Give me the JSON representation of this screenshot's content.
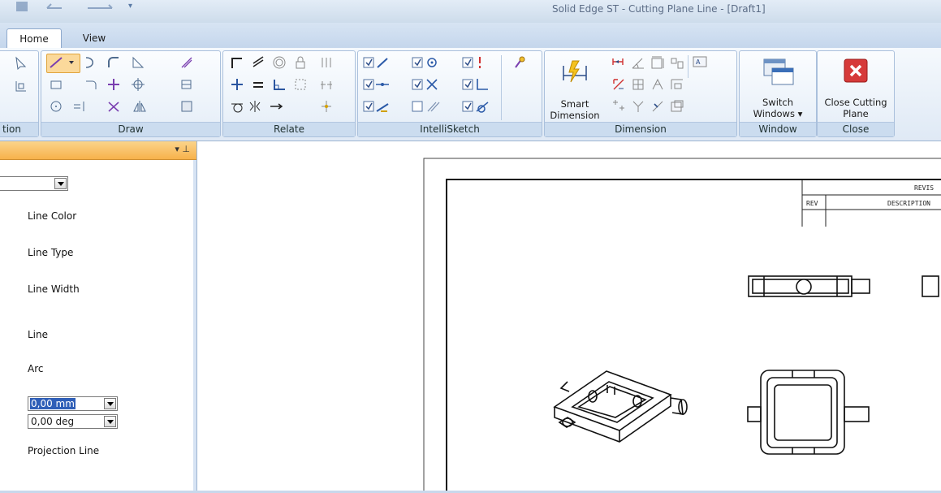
{
  "window": {
    "title": "Solid Edge ST - Cutting Plane Line - [Draft1]"
  },
  "tabs": {
    "home": "Home",
    "view": "View"
  },
  "ribbon": {
    "groups": {
      "selection": "tion",
      "draw": "Draw",
      "relate": "Relate",
      "intellisketch": "IntelliSketch",
      "dimension": "Dimension",
      "window": "Window",
      "close": "Close"
    },
    "smart_dimension_line1": "Smart",
    "smart_dimension_line2": "Dimension",
    "switch_windows_line1": "Switch",
    "switch_windows_line2": "Windows ▾",
    "close_cutting_plane_line1": "Close Cutting",
    "close_cutting_plane_line2": "Plane"
  },
  "panel": {
    "pin_glyphs": "▾ ⊥",
    "labels": {
      "line_color": "Line Color",
      "line_type": "Line Type",
      "line_width": "Line Width",
      "line": "Line",
      "arc": "Arc",
      "projection_line": "Projection Line"
    },
    "length_value": "0,00 mm",
    "angle_value": "0,00 deg"
  },
  "drawing": {
    "revisions_header": "REVIS",
    "rev_col": "REV",
    "description_col": "DESCRIPTION"
  },
  "colors": {
    "accent": "#f7b24b",
    "close_button": "#d63a3a",
    "ribbon_bg": "#dfe9f5"
  }
}
